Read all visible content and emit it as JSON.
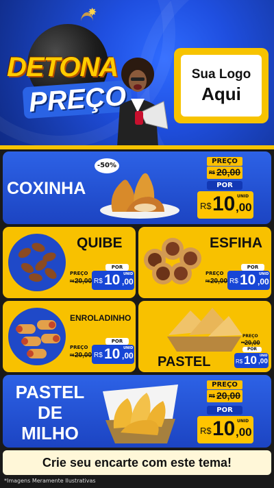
{
  "header": {
    "title_line1": "DETONA",
    "title_line2": "PREÇO",
    "logo_line1": "Sua Logo",
    "logo_line2": "Aqui"
  },
  "products": {
    "coxinha": {
      "name": "COXINHA",
      "discount": "-50%",
      "preco_label": "PREÇO",
      "old_prefix": "R$",
      "old_price": "20,00",
      "por_label": "POR",
      "currency": "R$",
      "price_int": "10",
      "price_dec": ",00",
      "unid": "UNID"
    },
    "quibe": {
      "name": "QUIBE",
      "preco_label": "PREÇO",
      "old_prefix": "R$",
      "old_price": "20,00",
      "por_label": "POR",
      "currency": "R$",
      "price_int": "10",
      "price_dec": ",00",
      "unid": "UNID"
    },
    "esfiha": {
      "name": "ESFIHA",
      "preco_label": "PREÇO",
      "old_prefix": "R$",
      "old_price": "20,00",
      "por_label": "POR",
      "currency": "R$",
      "price_int": "10",
      "price_dec": ",00",
      "unid": "UNID"
    },
    "enroladinho": {
      "name": "ENROLADINHO",
      "preco_label": "PREÇO",
      "old_prefix": "R$",
      "old_price": "20,00",
      "por_label": "POR",
      "currency": "R$",
      "price_int": "10",
      "price_dec": ",00",
      "unid": "UNID"
    },
    "pastel": {
      "name": "PASTEL",
      "preco_label": "PREÇO",
      "old_prefix": "R$",
      "old_price": "20,00",
      "por_label": "POR",
      "currency": "R$",
      "price_int": "10",
      "price_dec": ",00",
      "unid": "UNID"
    },
    "pastel_milho": {
      "name_line1": "PASTEL",
      "name_line2": "DE",
      "name_line3": "MILHO",
      "preco_label": "PREÇO",
      "old_prefix": "R$",
      "old_price": "20,00",
      "por_label": "POR",
      "currency": "R$",
      "price_int": "10",
      "price_dec": ",00",
      "unid": "UNID"
    }
  },
  "banner": {
    "text": "Crie seu encarte com este tema!"
  },
  "footer": {
    "note": "*Imagens Meramente Ilustrativas"
  },
  "colors": {
    "blue": "#2d62e6",
    "yellow": "#f8c100",
    "dark_blue": "#1238b5"
  }
}
